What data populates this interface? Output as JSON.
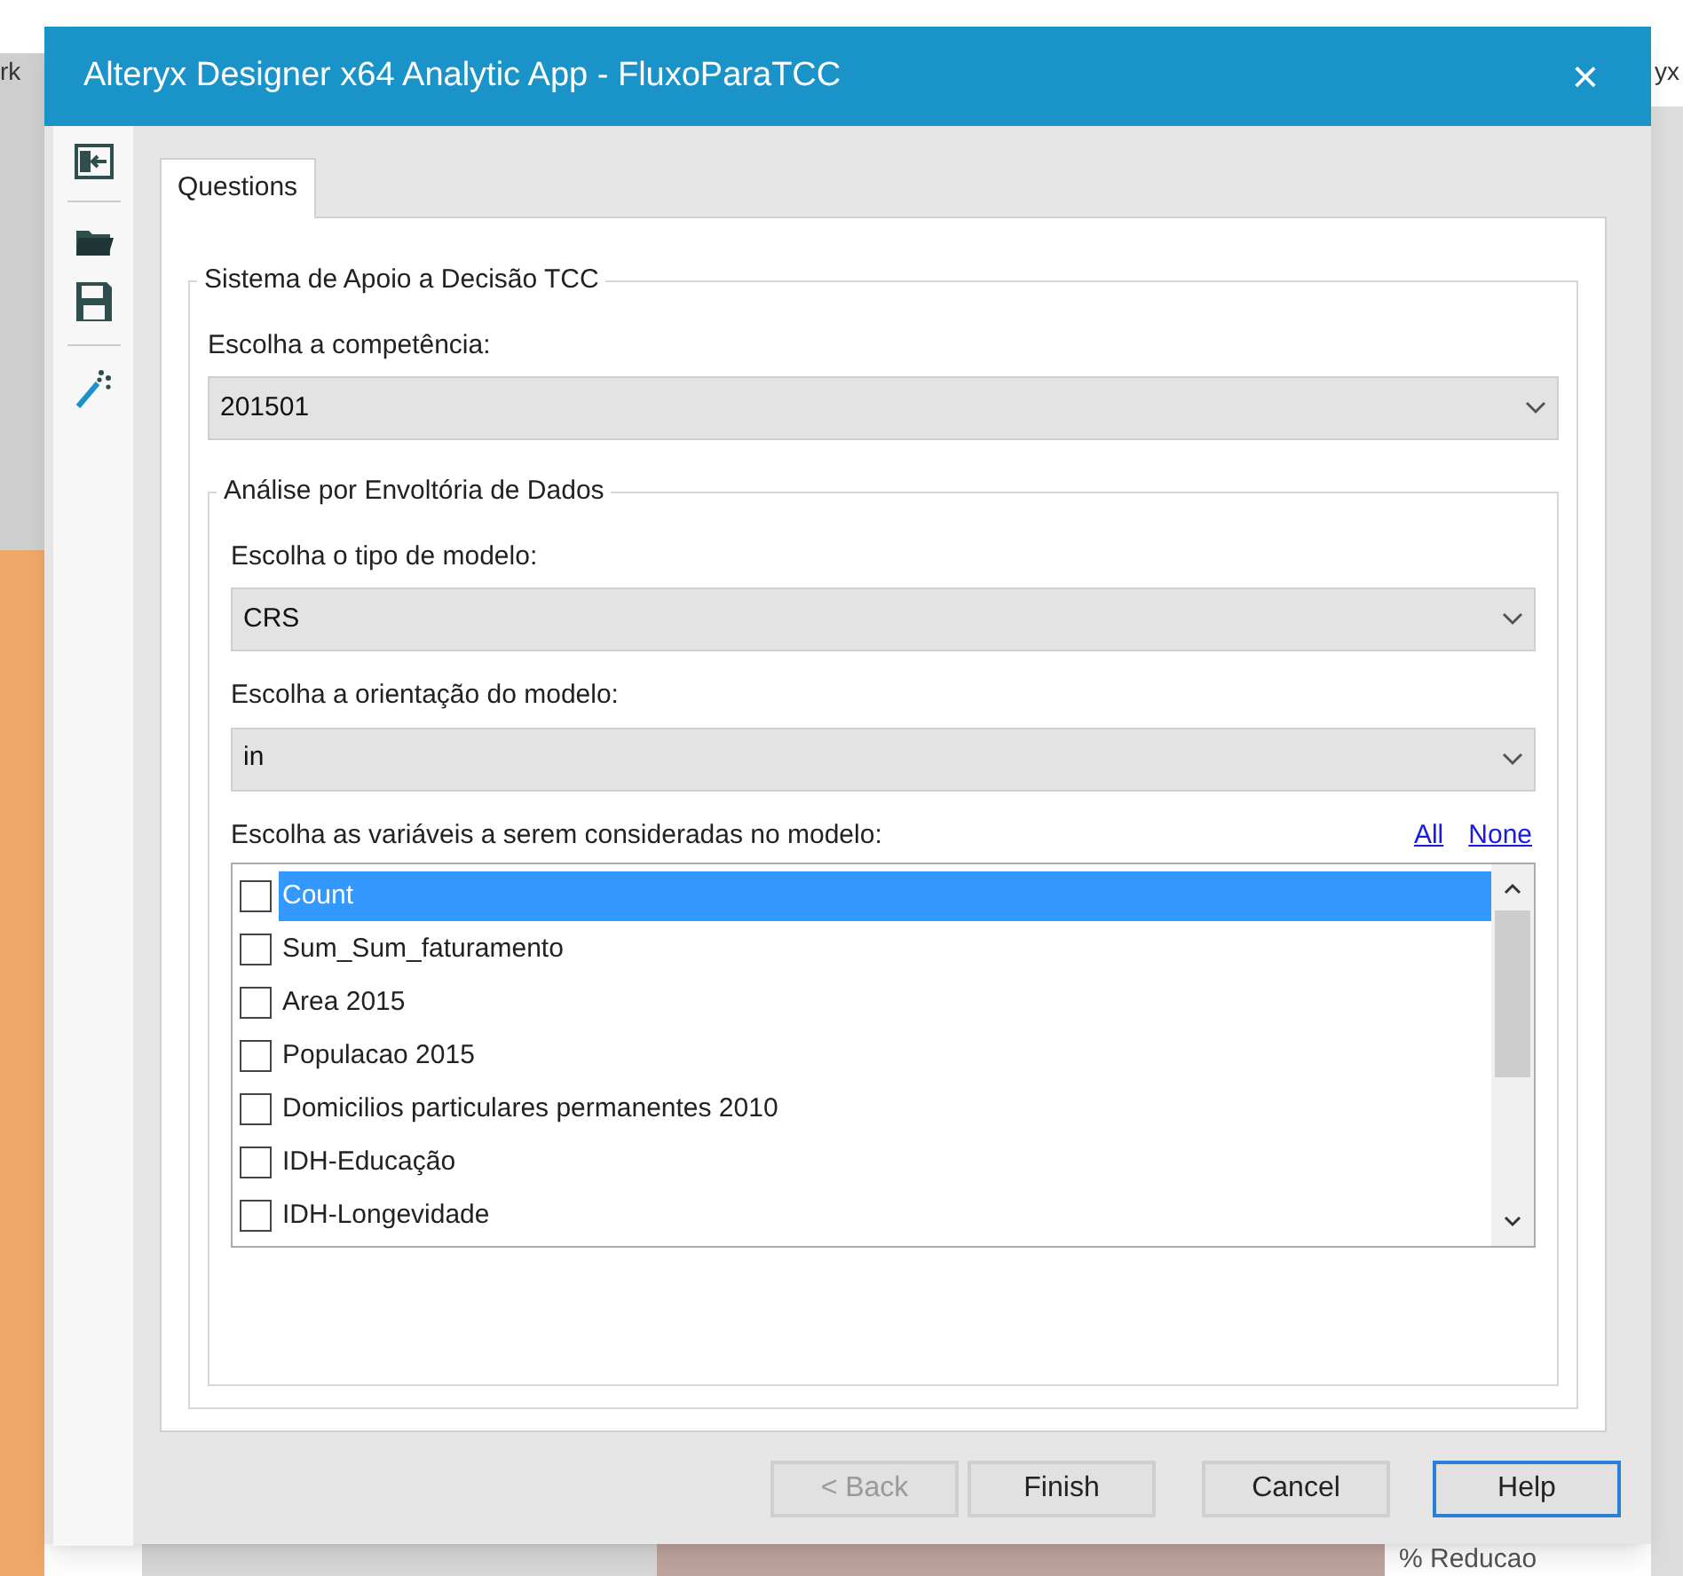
{
  "background": {
    "left_text": "rk",
    "right_text": "yx",
    "bottom_text": "% Reducao"
  },
  "window": {
    "title": "Alteryx Designer x64 Analytic App - FluxoParaTCC",
    "close": "×"
  },
  "tabs": [
    {
      "label": "Questions",
      "selected": true
    }
  ],
  "group": {
    "title": "Sistema de Apoio a Decisão TCC",
    "fields": [
      {
        "label": "Escolha a competência:",
        "value": "201501"
      }
    ],
    "subgroup": {
      "title": "Análise por Envoltória de Dados",
      "fields": [
        {
          "label": "Escolha o tipo de modelo:",
          "value": "CRS"
        },
        {
          "label": "Escolha a orientação do modelo:",
          "value": "in"
        }
      ],
      "variables": {
        "label": "Escolha as variáveis a serem consideradas no modelo:",
        "links": [
          "All",
          "None"
        ],
        "items": [
          {
            "label": "Count",
            "checked": false,
            "selected": true
          },
          {
            "label": "Sum_Sum_faturamento",
            "checked": false,
            "selected": false
          },
          {
            "label": "Area 2015",
            "checked": false,
            "selected": false
          },
          {
            "label": "Populacao 2015",
            "checked": false,
            "selected": false
          },
          {
            "label": "Domicilios particulares permanentes 2010",
            "checked": false,
            "selected": false
          },
          {
            "label": "IDH-Educação",
            "checked": false,
            "selected": false
          },
          {
            "label": "IDH-Longevidade",
            "checked": false,
            "selected": false
          }
        ]
      }
    }
  },
  "buttons": [
    {
      "label": "< Back",
      "disabled": true,
      "focused": false
    },
    {
      "label": "Finish",
      "disabled": false,
      "focused": false
    },
    {
      "label": "Cancel",
      "disabled": false,
      "focused": false
    },
    {
      "label": "Help",
      "disabled": false,
      "focused": true
    }
  ]
}
